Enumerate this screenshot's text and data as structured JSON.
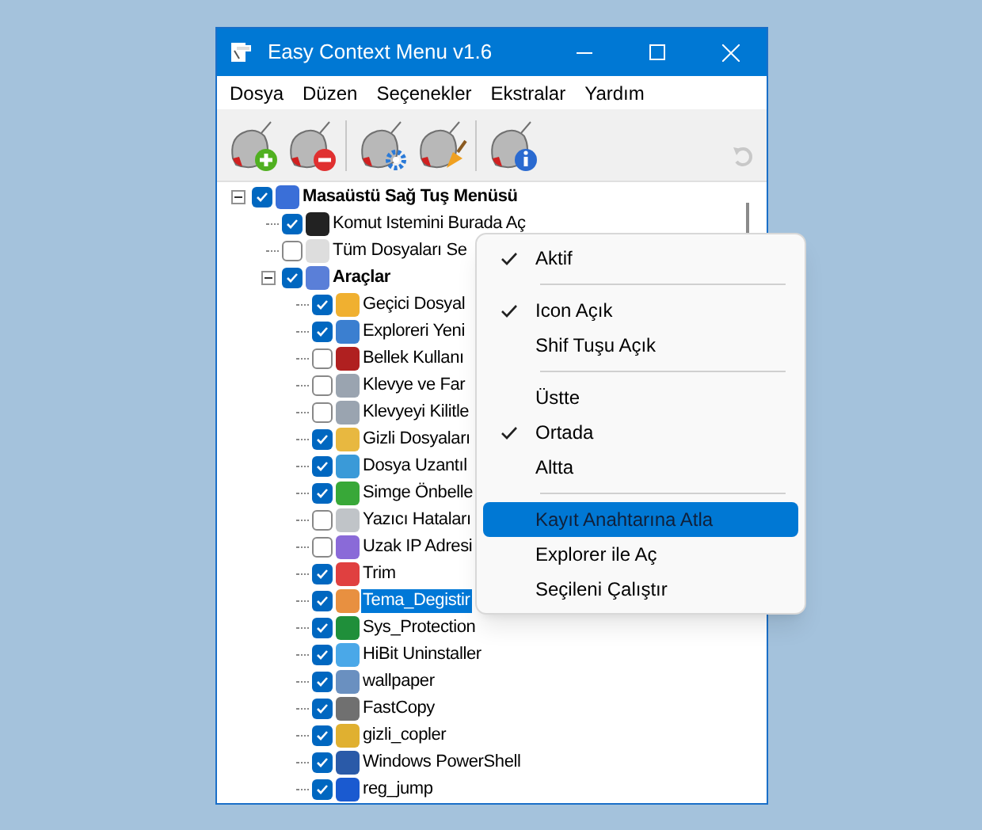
{
  "window": {
    "title": "Easy Context Menu v1.6"
  },
  "menu_bar": [
    "Dosya",
    "Düzen",
    "Seçenekler",
    "Ekstralar",
    "Yardım"
  ],
  "tree": [
    {
      "label": "Masaüstü Sağ Tuş Menüsü",
      "checked": true,
      "selected": false,
      "expanded": true,
      "children": [
        {
          "label": "Komut Istemini Burada Aç",
          "checked": true,
          "selected": false
        },
        {
          "label": "Tüm Dosyaları Se",
          "checked": false,
          "selected": false
        },
        {
          "label": "Araçlar",
          "checked": true,
          "selected": false,
          "expanded": true,
          "children": [
            {
              "label": "Geçici Dosyal",
              "checked": true,
              "selected": false
            },
            {
              "label": "Exploreri Yeni",
              "checked": true,
              "selected": false
            },
            {
              "label": "Bellek Kullanı",
              "checked": false,
              "selected": false
            },
            {
              "label": "Klevye ve Far",
              "checked": false,
              "selected": false
            },
            {
              "label": "Klevyeyi Kilitle",
              "checked": false,
              "selected": false
            },
            {
              "label": "Gizli Dosyaları",
              "checked": true,
              "selected": false
            },
            {
              "label": "Dosya Uzantıl",
              "checked": true,
              "selected": false
            },
            {
              "label": "Simge Önbelle",
              "checked": true,
              "selected": false
            },
            {
              "label": "Yazıcı Hataları",
              "checked": false,
              "selected": false
            },
            {
              "label": "Uzak IP Adresi",
              "checked": false,
              "selected": false
            },
            {
              "label": "Trim",
              "checked": true,
              "selected": false
            },
            {
              "label": "Tema_Degistir",
              "checked": true,
              "selected": true
            },
            {
              "label": "Sys_Protection",
              "checked": true,
              "selected": false
            },
            {
              "label": "HiBit Uninstaller",
              "checked": true,
              "selected": false
            },
            {
              "label": "wallpaper",
              "checked": true,
              "selected": false
            },
            {
              "label": "FastCopy",
              "checked": true,
              "selected": false
            },
            {
              "label": "gizli_copler",
              "checked": true,
              "selected": false
            },
            {
              "label": "Windows PowerShell",
              "checked": true,
              "selected": false
            },
            {
              "label": "reg_jump",
              "checked": true,
              "selected": false
            }
          ]
        }
      ]
    }
  ],
  "context_menu": [
    {
      "kind": "item",
      "label": "Aktif",
      "checked": true,
      "selected": false
    },
    {
      "kind": "separator"
    },
    {
      "kind": "item",
      "label": "Icon Açık",
      "checked": true,
      "selected": false
    },
    {
      "kind": "item",
      "label": "Shif Tuşu Açık",
      "checked": false,
      "selected": false
    },
    {
      "kind": "separator"
    },
    {
      "kind": "item",
      "label": "Üstte",
      "checked": false,
      "selected": false
    },
    {
      "kind": "item",
      "label": "Ortada",
      "checked": true,
      "selected": false
    },
    {
      "kind": "item",
      "label": "Altta",
      "checked": false,
      "selected": false
    },
    {
      "kind": "separator"
    },
    {
      "kind": "item",
      "label": "Kayıt Anahtarına Atla",
      "checked": false,
      "selected": true
    },
    {
      "kind": "item",
      "label": "Explorer ile Aç",
      "checked": false,
      "selected": false
    },
    {
      "kind": "item",
      "label": "Seçileni Çalıştır",
      "checked": false,
      "selected": false
    }
  ]
}
